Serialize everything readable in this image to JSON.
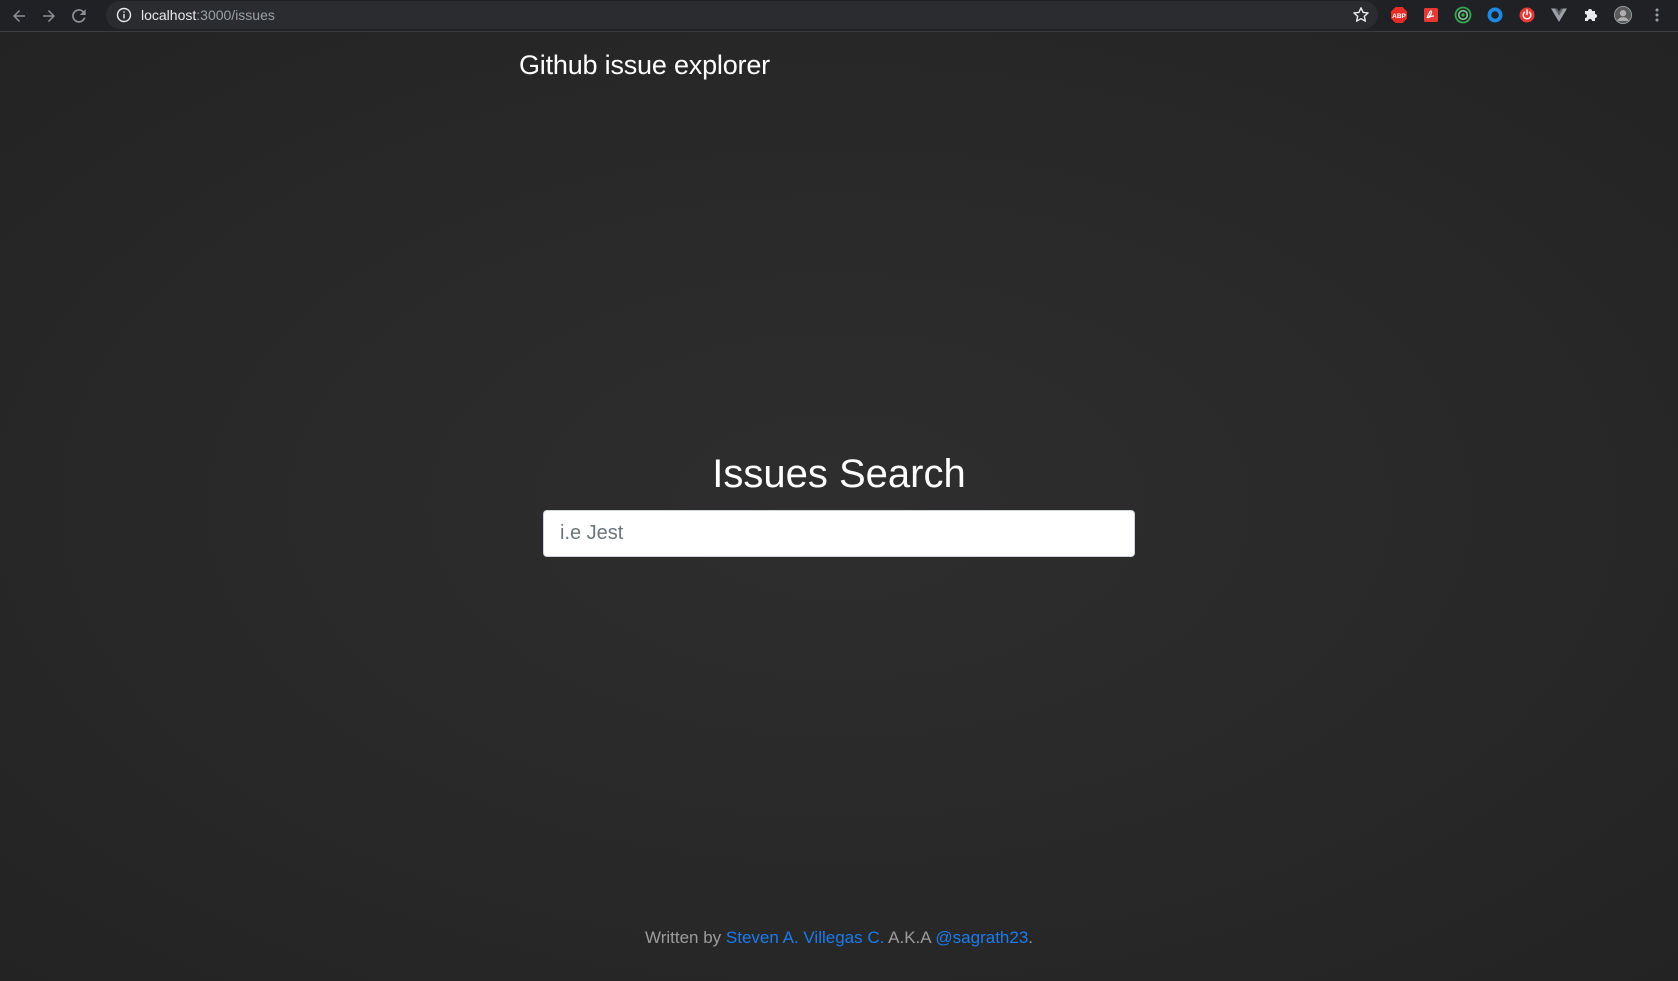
{
  "browser": {
    "url_host": "localhost",
    "url_path": ":3000/issues",
    "icons": {
      "back": "back-arrow-icon",
      "forward": "forward-arrow-icon",
      "reload": "reload-icon",
      "info": "info-icon",
      "bookmark": "star-icon"
    },
    "extensions": [
      {
        "name": "adblock-plus-icon",
        "label": "ABP",
        "color": "#e52d27"
      },
      {
        "name": "pdf-extension-icon",
        "label": "",
        "color": "#e53935"
      },
      {
        "name": "target-extension-icon",
        "label": "",
        "color": "#34a853"
      },
      {
        "name": "circle-extension-icon",
        "label": "",
        "color": "#1e88e5"
      },
      {
        "name": "power-extension-icon",
        "label": "",
        "color": "#e53935"
      },
      {
        "name": "vue-devtools-icon",
        "label": "",
        "color": "#9aa0a6"
      },
      {
        "name": "puzzle-icon",
        "label": "",
        "color": "#e8eaed"
      },
      {
        "name": "profile-avatar",
        "label": "",
        "color": "#8e8e8e"
      },
      {
        "name": "kebab-menu-icon",
        "label": "",
        "color": "#9aa0a6"
      }
    ]
  },
  "header": {
    "title": "Github issue explorer"
  },
  "search": {
    "heading": "Issues Search",
    "placeholder": "i.e Jest",
    "value": ""
  },
  "footer": {
    "prefix": "Written by",
    "author_link": "Steven A. Villegas C.",
    "aka": "A.K.A",
    "handle_link": "@sagrath23",
    "suffix": "."
  },
  "colors": {
    "background": "#2a2a2a",
    "link": "#1a7bef",
    "title": "#ffffff",
    "footer_text": "#9c9c9c"
  }
}
